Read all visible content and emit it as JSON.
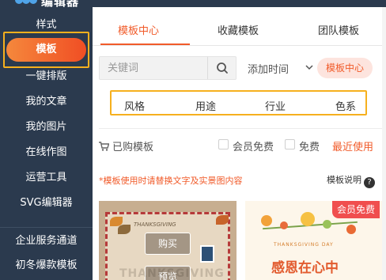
{
  "app": {
    "logo_text": "编辑器"
  },
  "sidebar": {
    "items": [
      {
        "label": "样式"
      },
      {
        "label": "模板"
      },
      {
        "label": "一键排版"
      },
      {
        "label": "我的文章"
      },
      {
        "label": "我的图片"
      },
      {
        "label": "在线作图"
      },
      {
        "label": "运营工具"
      },
      {
        "label": "SVG编辑器"
      },
      {
        "label": "企业服务通道"
      },
      {
        "label": "初冬爆款模板"
      }
    ],
    "active_index": 1
  },
  "tabs": {
    "items": [
      {
        "label": "模板中心"
      },
      {
        "label": "收藏模板"
      },
      {
        "label": "团队模板"
      }
    ],
    "active_index": 0
  },
  "search": {
    "placeholder": "关键词",
    "value": ""
  },
  "sort": {
    "label": "添加时间",
    "options_selected": "添加时间"
  },
  "center_button": {
    "label": "模板中心"
  },
  "filters": {
    "items": [
      {
        "label": "风格"
      },
      {
        "label": "用途"
      },
      {
        "label": "行业"
      },
      {
        "label": "色系"
      }
    ]
  },
  "options_row": {
    "purchased_label": "已购模板",
    "member_free_label": "会员免费",
    "free_label": "免费",
    "recent_label": "最近使用"
  },
  "notice": {
    "text": "*模板使用时请替换文字及实景图内容",
    "help_label": "模板说明",
    "help_icon_glyph": "?"
  },
  "cards": [
    {
      "buy_label": "购买",
      "preview_label": "预览",
      "small_title": "THANKSGIVING",
      "big_title": "THANKSGIVING"
    },
    {
      "badge": "会员免费",
      "small_title": "THANKSGIVING DAY",
      "big_title": "感恩在心中"
    }
  ],
  "colors": {
    "sidebar_bg": "#2b3a4e",
    "accent": "#f15b2a",
    "highlight_border": "#f6b01e",
    "badge_red": "#f04e4e"
  }
}
